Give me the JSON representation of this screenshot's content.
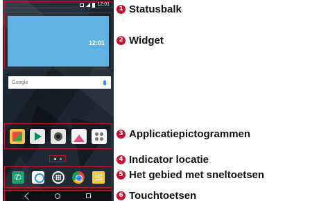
{
  "phone": {
    "status_time": "12:01",
    "widget_time": "12:01",
    "search_logo": "Google",
    "apps_row": [
      "gallery-app-icon",
      "play-store-icon",
      "camera-icon",
      "photos-icon",
      "app-folder-icon"
    ],
    "quick_keys": [
      "phone-icon",
      "contacts-icon",
      "apps-icon",
      "chrome-icon",
      "memo-icon"
    ],
    "touch_keys": [
      "back-icon",
      "home-icon",
      "recent-apps-icon"
    ],
    "page_indicator": {
      "pages": 2,
      "active": 1
    }
  },
  "callouts": [
    {
      "number": "1",
      "label": "Statusbalk"
    },
    {
      "number": "2",
      "label": "Widget"
    },
    {
      "number": "3",
      "label": "Applicatiepictogrammen"
    },
    {
      "number": "4",
      "label": "Indicator locatie"
    },
    {
      "number": "5",
      "label": "Het gebied met sneltoetsen"
    },
    {
      "number": "6",
      "label": "Touchtoetsen"
    }
  ],
  "colors": {
    "callout_accent": "#c8102e",
    "widget_bg": "#5fb3e3"
  }
}
